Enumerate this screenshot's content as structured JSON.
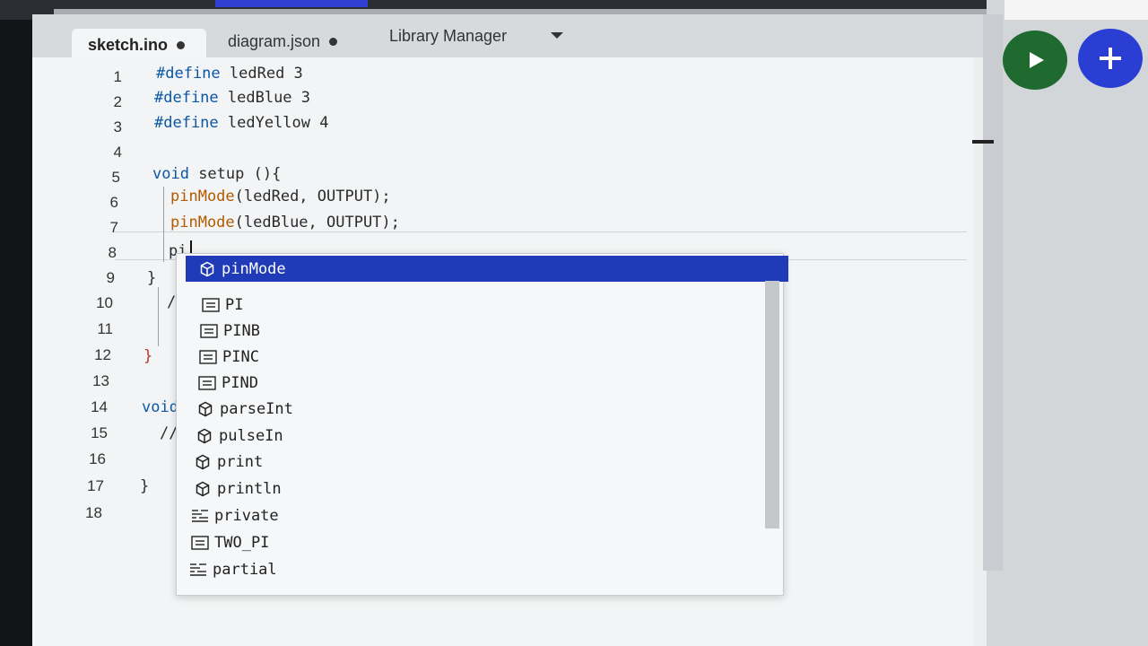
{
  "tabs": [
    {
      "label": "sketch.ino",
      "modified": true
    },
    {
      "label": "diagram.json",
      "modified": true
    },
    {
      "label": "Library Manager"
    }
  ],
  "line_numbers": [
    "1",
    "2",
    "3",
    "4",
    "5",
    "6",
    "7",
    "8",
    "9",
    "10",
    "11",
    "12",
    "13",
    "14",
    "15",
    "16",
    "17",
    "18"
  ],
  "code": {
    "l1_kw": "#define",
    "l1_rest": " ledRed 3",
    "l2_kw": "#define",
    "l2_rest": " ledBlue 3",
    "l3_kw": "#define",
    "l3_rest": " ledYellow 4",
    "l5_kw": "void",
    "l5_rest": " setup (){",
    "l6_fn": "pinMode",
    "l6_rest": "(ledRed, OUTPUT);",
    "l7_fn": "pinMode",
    "l7_rest": "(ledBlue, OUTPUT);",
    "l8": "pi",
    "l9": "}",
    "l10": "//",
    "l12": "}",
    "l14_kw": "void",
    "l15": "//",
    "l17": "}"
  },
  "autocomplete": {
    "items": [
      {
        "label": "pinMode",
        "icon": "method-cube-icon",
        "selected": true
      },
      {
        "label": "PI",
        "icon": "constant-icon"
      },
      {
        "label": "PINB",
        "icon": "constant-icon"
      },
      {
        "label": "PINC",
        "icon": "constant-icon"
      },
      {
        "label": "PIND",
        "icon": "constant-icon"
      },
      {
        "label": "parseInt",
        "icon": "method-cube-icon"
      },
      {
        "label": "pulseIn",
        "icon": "method-cube-icon"
      },
      {
        "label": "print",
        "icon": "method-cube-icon"
      },
      {
        "label": "println",
        "icon": "method-cube-icon"
      },
      {
        "label": "private",
        "icon": "keyword-icon"
      },
      {
        "label": "TWO_PI",
        "icon": "constant-icon"
      },
      {
        "label": "partial",
        "icon": "keyword-icon"
      }
    ]
  },
  "colors": {
    "run": "#1f6b2f",
    "add": "#2a3ed4",
    "selection": "#1f3bb8"
  }
}
